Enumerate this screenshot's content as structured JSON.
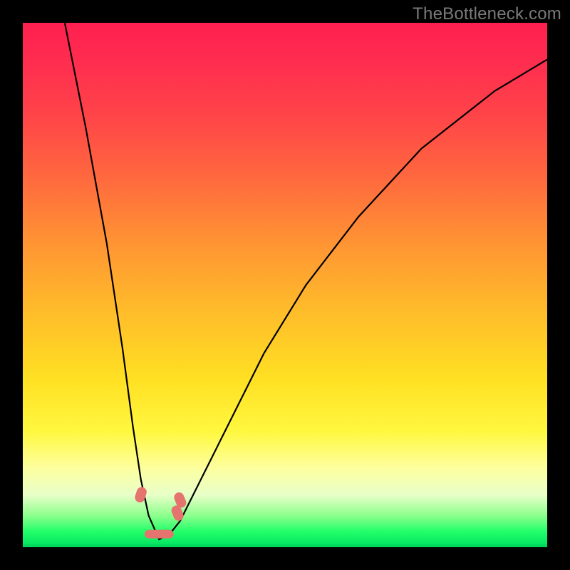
{
  "watermark": "TheBottleneck.com",
  "chart_data": {
    "type": "line",
    "title": "",
    "xlabel": "",
    "ylabel": "",
    "xlim": [
      0,
      100
    ],
    "ylim": [
      0,
      100
    ],
    "grid": false,
    "note": "V-shaped bottleneck curve; minimum (0% bottleneck) near x≈26. Values estimated from pixel positions relative to plot area.",
    "series": [
      {
        "name": "bottleneck-curve",
        "x": [
          8,
          12,
          16,
          19,
          21,
          22.5,
          24,
          26,
          28,
          30,
          32,
          35,
          40,
          46,
          54,
          64,
          76,
          90,
          100
        ],
        "values": [
          100,
          80,
          58,
          38,
          23,
          13,
          6,
          1.5,
          2.5,
          5,
          9,
          15,
          25,
          37,
          50,
          63,
          76,
          87,
          93
        ]
      }
    ],
    "markers": [
      {
        "x": 22.5,
        "y": 10,
        "label": "marker-left",
        "color": "#e5736e"
      },
      {
        "x": 25,
        "y": 2.5,
        "label": "marker-bottom-a",
        "color": "#e5736e"
      },
      {
        "x": 27,
        "y": 2.5,
        "label": "marker-bottom-b",
        "color": "#e5736e"
      },
      {
        "x": 29.5,
        "y": 6.5,
        "label": "marker-right-lower",
        "color": "#e5736e"
      },
      {
        "x": 30,
        "y": 9,
        "label": "marker-right-upper",
        "color": "#e5736e"
      }
    ],
    "background_gradient": {
      "top": "#ff1f4f",
      "mid": "#ffbc2a",
      "lower": "#fff840",
      "bottom": "#00e060"
    },
    "curve_color": "#000000",
    "marker_color": "#e5736e"
  }
}
